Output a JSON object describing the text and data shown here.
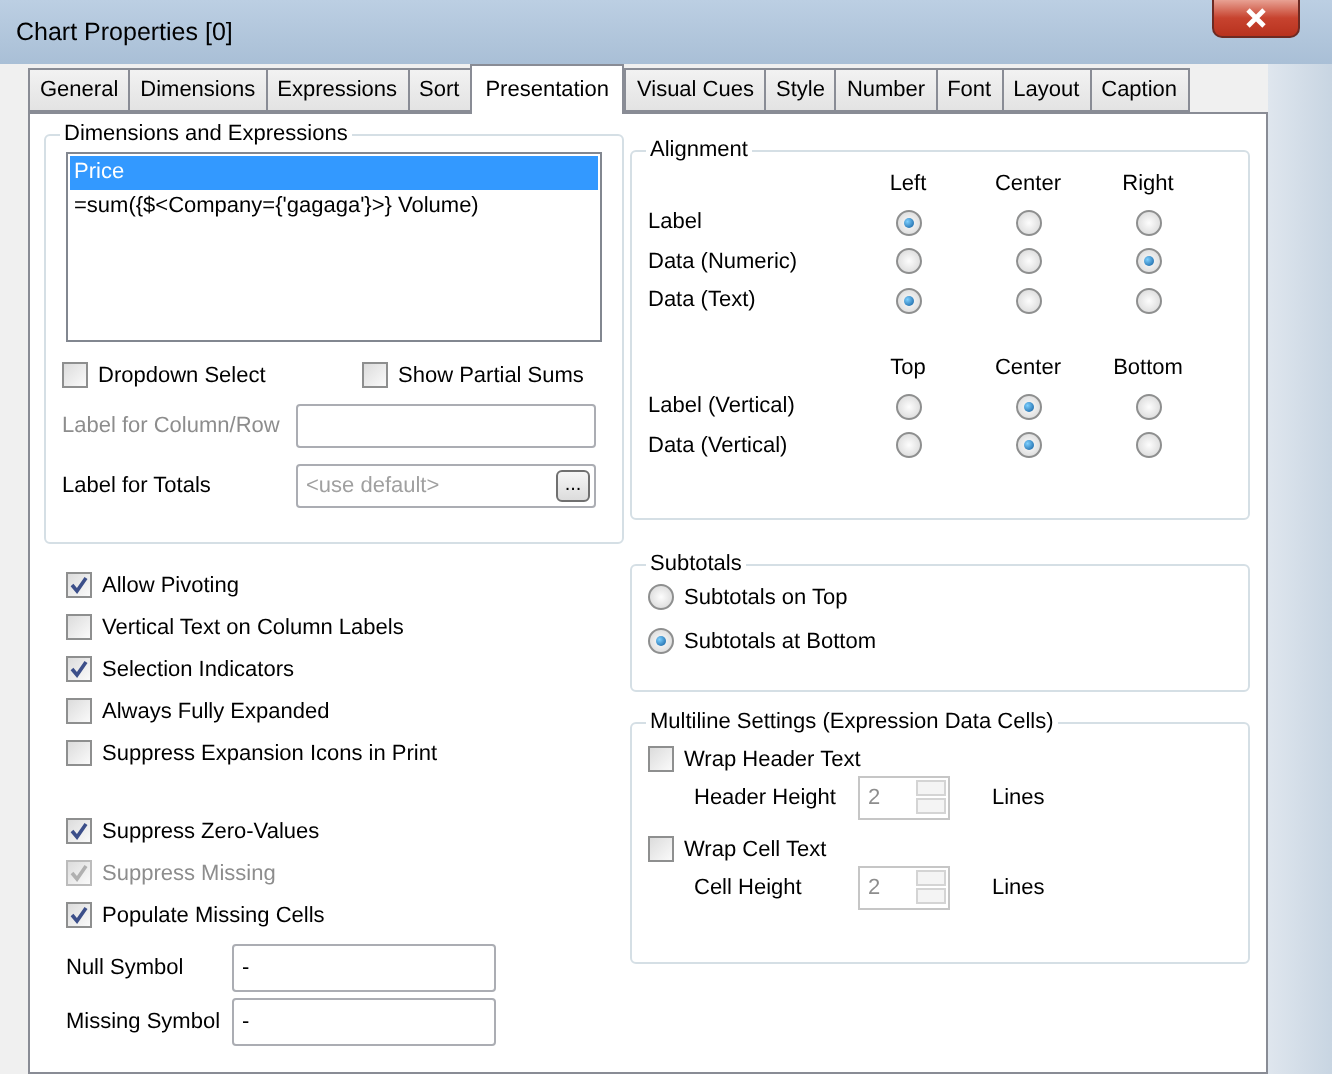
{
  "window": {
    "title": "Chart Properties [0]"
  },
  "tabs": [
    {
      "label": "General",
      "selected": false
    },
    {
      "label": "Dimensions",
      "selected": false
    },
    {
      "label": "Expressions",
      "selected": false
    },
    {
      "label": "Sort",
      "selected": false
    },
    {
      "label": "Presentation",
      "selected": true
    },
    {
      "label": "Visual Cues",
      "selected": false
    },
    {
      "label": "Style",
      "selected": false
    },
    {
      "label": "Number",
      "selected": false
    },
    {
      "label": "Font",
      "selected": false
    },
    {
      "label": "Layout",
      "selected": false
    },
    {
      "label": "Caption",
      "selected": false
    }
  ],
  "dimensions_and_expressions": {
    "title": "Dimensions and Expressions",
    "items": [
      {
        "text": "Price",
        "selected": true
      },
      {
        "text": "=sum({$<Company={'gagaga'}>} Volume)",
        "selected": false
      }
    ],
    "dropdown_select": {
      "label": "Dropdown Select",
      "checked": false
    },
    "show_partial_sums": {
      "label": "Show Partial Sums",
      "checked": false
    },
    "label_for_column_row": {
      "label": "Label for Column/Row",
      "disabled": true
    },
    "label_for_totals": {
      "label": "Label for Totals",
      "disabled": false,
      "placeholder": "<use default>",
      "button": "..."
    }
  },
  "alignment": {
    "title": "Alignment",
    "horizontal": {
      "columns": [
        "Left",
        "Center",
        "Right"
      ],
      "rows": [
        {
          "label": "Label",
          "options": [
            {
              "selected": true
            },
            {
              "selected": false
            },
            {
              "selected": false
            }
          ]
        },
        {
          "label": "Data (Numeric)",
          "options": [
            {
              "selected": false
            },
            {
              "selected": false
            },
            {
              "selected": true
            }
          ]
        },
        {
          "label": "Data (Text)",
          "options": [
            {
              "selected": true
            },
            {
              "selected": false
            },
            {
              "selected": false
            }
          ]
        }
      ]
    },
    "vertical": {
      "columns": [
        "Top",
        "Center",
        "Bottom"
      ],
      "rows": [
        {
          "label": "Label (Vertical)",
          "options": [
            {
              "selected": false
            },
            {
              "selected": true
            },
            {
              "selected": false
            }
          ]
        },
        {
          "label": "Data (Vertical)",
          "options": [
            {
              "selected": false
            },
            {
              "selected": true
            },
            {
              "selected": false
            }
          ]
        }
      ]
    }
  },
  "display_options": [
    {
      "label": "Allow Pivoting",
      "checked": true,
      "disabled": false
    },
    {
      "label": "Vertical Text on Column Labels",
      "checked": false,
      "disabled": false
    },
    {
      "label": "Selection Indicators",
      "checked": true,
      "disabled": false
    },
    {
      "label": "Always Fully Expanded",
      "checked": false,
      "disabled": false
    },
    {
      "label": "Suppress Expansion Icons in Print",
      "checked": false,
      "disabled": false
    }
  ],
  "suppress_options": [
    {
      "label": "Suppress Zero-Values",
      "checked": true,
      "disabled": false
    },
    {
      "label": "Suppress Missing",
      "checked": true,
      "disabled": true
    },
    {
      "label": "Populate Missing Cells",
      "checked": true,
      "disabled": false
    }
  ],
  "symbols": [
    {
      "label": "Null Symbol",
      "value": "-"
    },
    {
      "label": "Missing Symbol",
      "value": "-"
    }
  ],
  "subtotals": {
    "title": "Subtotals",
    "options": [
      {
        "label": "Subtotals on Top",
        "selected": false
      },
      {
        "label": "Subtotals at Bottom",
        "selected": true
      }
    ]
  },
  "multiline_settings": {
    "title": "Multiline Settings (Expression Data Cells)",
    "items": [
      {
        "label": "Wrap Header Text",
        "checked": false,
        "height_label": "Header Height",
        "value": "2",
        "unit": "Lines",
        "disabled": true
      },
      {
        "label": "Wrap Cell Text",
        "checked": false,
        "height_label": "Cell Height",
        "value": "2",
        "unit": "Lines",
        "disabled": true
      }
    ]
  }
}
